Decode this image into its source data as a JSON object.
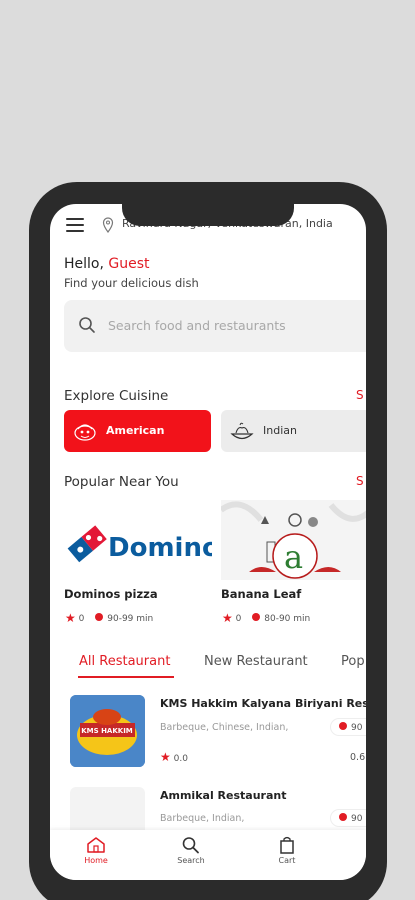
{
  "location": "Ravindra Nagar, Venkateswaran, India",
  "greeting": {
    "hello": "Hello,",
    "name": "Guest",
    "subtitle": "Find your delicious dish"
  },
  "search": {
    "placeholder": "Search food and restaurants"
  },
  "cuisine": {
    "title": "Explore Cuisine",
    "see_all": "S",
    "items": [
      {
        "label": "American",
        "active": true
      },
      {
        "label": "Indian",
        "active": false
      }
    ]
  },
  "popular": {
    "title": "Popular Near You",
    "see_all": "S",
    "restaurants": [
      {
        "name": "Dominos pizza",
        "logo_text": "Domino",
        "rating": "0",
        "time": "90-99 min"
      },
      {
        "name": "Banana Leaf",
        "rating": "0",
        "time": "80-90 min"
      }
    ]
  },
  "tabs": [
    "All Restaurant",
    "New Restaurant",
    "Pop"
  ],
  "list": [
    {
      "name": "KMS Hakkim Kalyana Biriyani Restau",
      "cuisine": "Barbeque, Chinese, Indian,",
      "time": "90",
      "rating": "0.0",
      "distance": "0.6",
      "thumb_text": "KMS HAKKIM"
    },
    {
      "name": "Ammikal Restaurant",
      "cuisine": "Barbeque, Indian,",
      "time": "90"
    }
  ],
  "bottom_nav": {
    "home": "Home",
    "search": "Search",
    "cart": "Cart"
  },
  "colors": {
    "accent": "#e11c24",
    "chip_active": "#f2121a",
    "dominos_blue": "#0b5c9e"
  }
}
